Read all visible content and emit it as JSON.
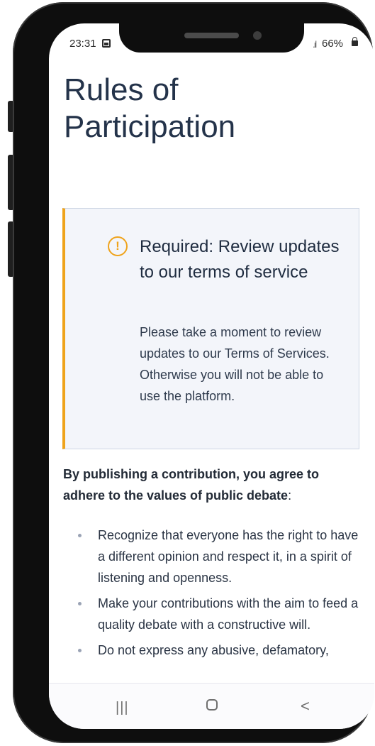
{
  "status_bar": {
    "time": "23:31",
    "image_icon": "image-icon",
    "signal_icon": "signal-icon",
    "signal_glyph": ".ıl",
    "battery": "66%",
    "battery_icon": "lock-icon"
  },
  "page": {
    "title": "Rules of Participation"
  },
  "notice": {
    "icon": "warning-circle-icon",
    "icon_glyph": "!",
    "title": "Required: Review updates to our terms of service",
    "body": "Please take a moment to review updates to our Terms of Services. Otherwise you will not be able to use the platform.",
    "accent_color": "#efa31b"
  },
  "intro": {
    "bold_text": "By publishing a contribution, you agree to adhere to the values of public debate",
    "suffix": ":"
  },
  "rules": [
    "Recognize that everyone has the right to have a different opinion and respect it, in a spirit of listening and openness.",
    "Make your contributions with the aim to feed a quality debate with a constructive will.",
    "Do not express any abusive, defamatory,"
  ],
  "nav_bar": {
    "recent_glyph": "|||",
    "back_glyph": "<"
  }
}
